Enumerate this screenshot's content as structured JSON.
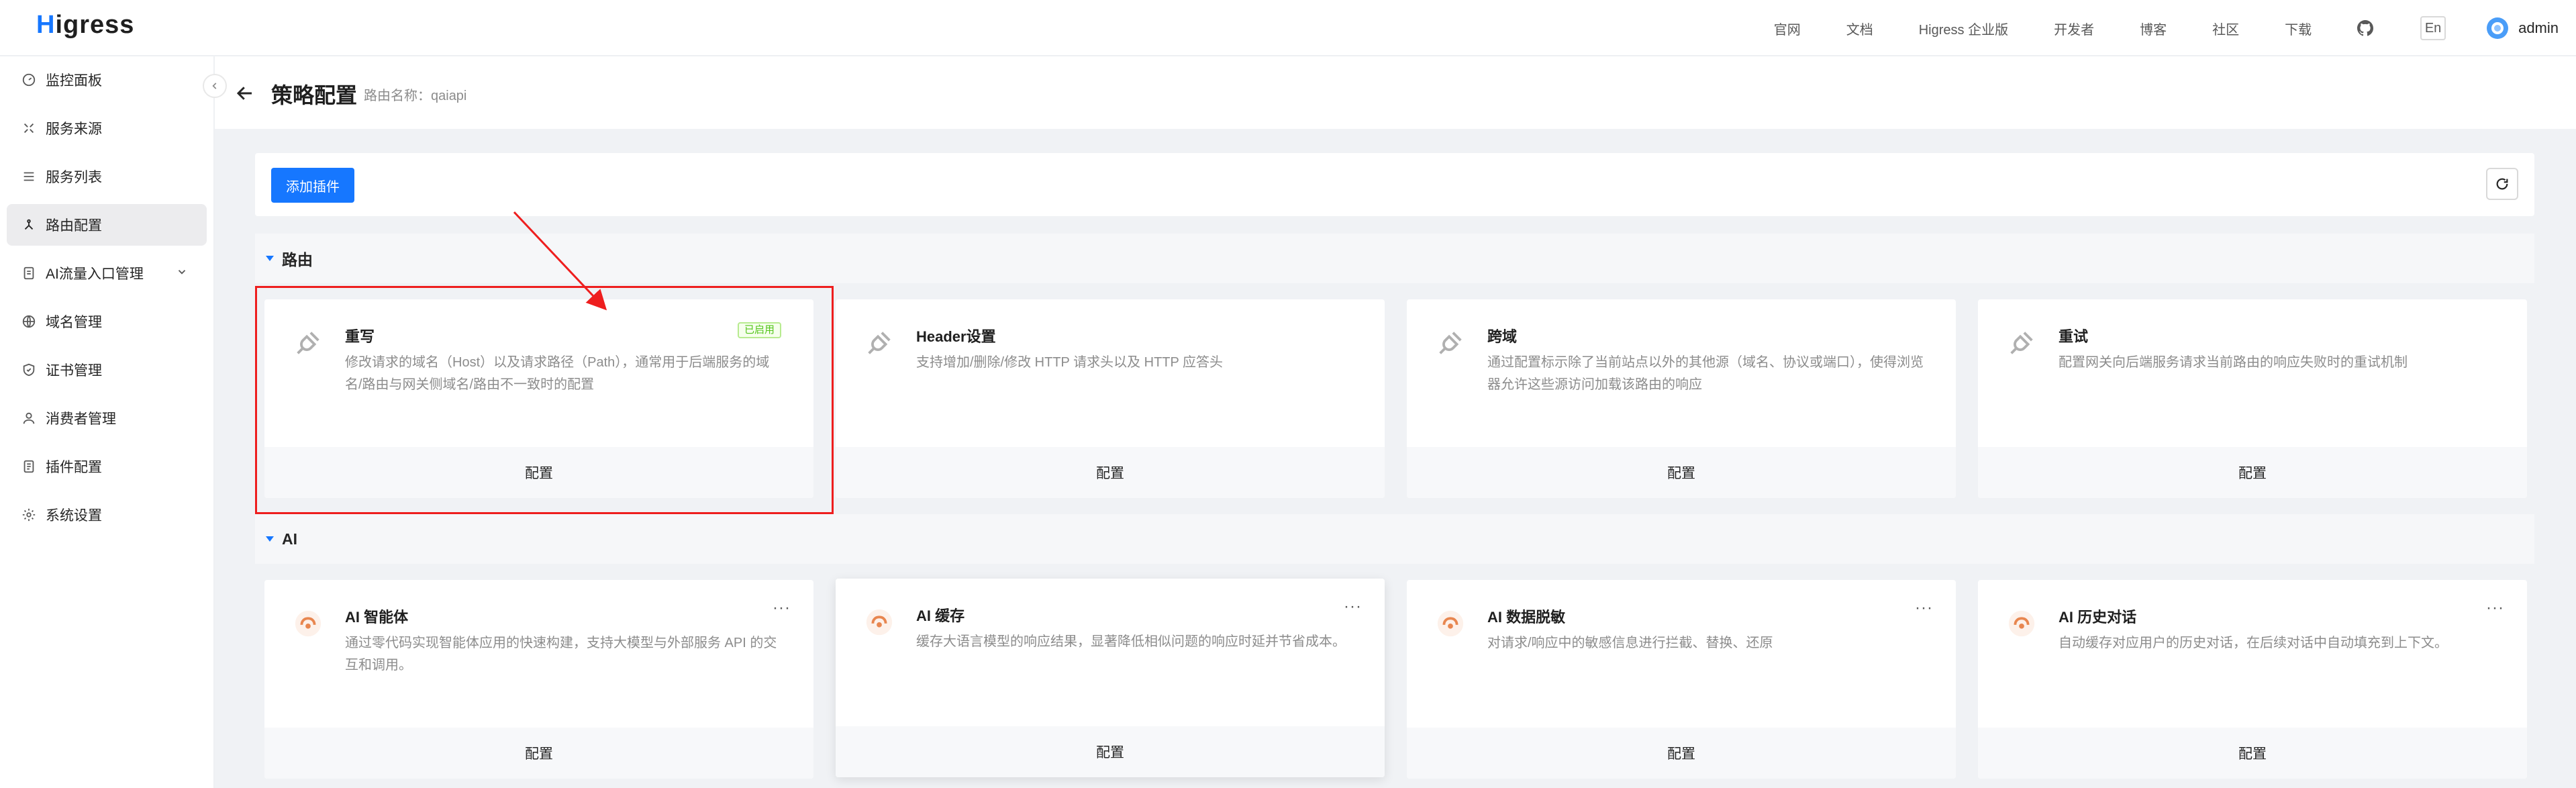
{
  "header": {
    "logo_text": "igress",
    "logo_mark": "H",
    "nav": [
      "官网",
      "文档",
      "Higress 企业版",
      "开发者",
      "博客",
      "社区",
      "下载"
    ],
    "github_icon": "github-icon",
    "lang": "En",
    "user": "admin"
  },
  "sidebar": {
    "items": [
      {
        "label": "监控面板",
        "icon": "dashboard-icon"
      },
      {
        "label": "服务来源",
        "icon": "service-source-icon"
      },
      {
        "label": "服务列表",
        "icon": "list-icon"
      },
      {
        "label": "路由配置",
        "icon": "route-icon",
        "active": true
      },
      {
        "label": "AI流量入口管理",
        "icon": "ai-gateway-icon",
        "expandable": true
      },
      {
        "label": "域名管理",
        "icon": "globe-icon"
      },
      {
        "label": "证书管理",
        "icon": "shield-icon"
      },
      {
        "label": "消费者管理",
        "icon": "user-icon"
      },
      {
        "label": "插件配置",
        "icon": "plugin-icon"
      },
      {
        "label": "系统设置",
        "icon": "settings-icon"
      }
    ],
    "collapse_icon": "chevron-left-icon"
  },
  "page": {
    "title": "策略配置",
    "route_label": "路由名称：qaiapi"
  },
  "toolbar": {
    "add_label": "添加插件",
    "refresh_icon": "refresh-icon"
  },
  "sections": [
    {
      "title": "路由",
      "cards": [
        {
          "title": "重写",
          "desc": "修改请求的域名（Host）以及请求路径（Path），通常用于后端服务的域名/路由与网关侧域名/路由不一致时的配置",
          "badge": "已启用",
          "footer": "配置",
          "icon": "plug-icon"
        },
        {
          "title": "Header设置",
          "desc": "支持增加/删除/修改 HTTP 请求头以及 HTTP 应答头",
          "footer": "配置",
          "icon": "plug-icon"
        },
        {
          "title": "跨域",
          "desc": "通过配置标示除了当前站点以外的其他源（域名、协议或端口），使得浏览器允许这些源访问加载该路由的响应",
          "footer": "配置",
          "icon": "plug-icon"
        },
        {
          "title": "重试",
          "desc": "配置网关向后端服务请求当前路由的响应失败时的重试机制",
          "footer": "配置",
          "icon": "plug-icon"
        }
      ]
    },
    {
      "title": "AI",
      "cards": [
        {
          "title": "AI 智能体",
          "desc": "通过零代码实现智能体应用的快速构建，支持大模型与外部服务 API 的交互和调用。",
          "footer": "配置",
          "more": "···",
          "icon": "ai-plugin-icon"
        },
        {
          "title": "AI 缓存",
          "desc": "缓存大语言模型的响应结果，显著降低相似问题的响应时延并节省成本。",
          "footer": "配置",
          "more": "···",
          "icon": "ai-plugin-icon"
        },
        {
          "title": "AI 数据脱敏",
          "desc": "对请求/响应中的敏感信息进行拦截、替换、还原",
          "footer": "配置",
          "more": "···",
          "icon": "ai-plugin-icon"
        },
        {
          "title": "AI 历史对话",
          "desc": "自动缓存对应用户的历史对话，在后续对话中自动填充到上下文。",
          "footer": "配置",
          "more": "···",
          "icon": "ai-plugin-icon"
        }
      ]
    }
  ],
  "colors": {
    "primary": "#1677ff",
    "annotation": "#ee1e1e",
    "enabled_green": "#52c41a"
  }
}
